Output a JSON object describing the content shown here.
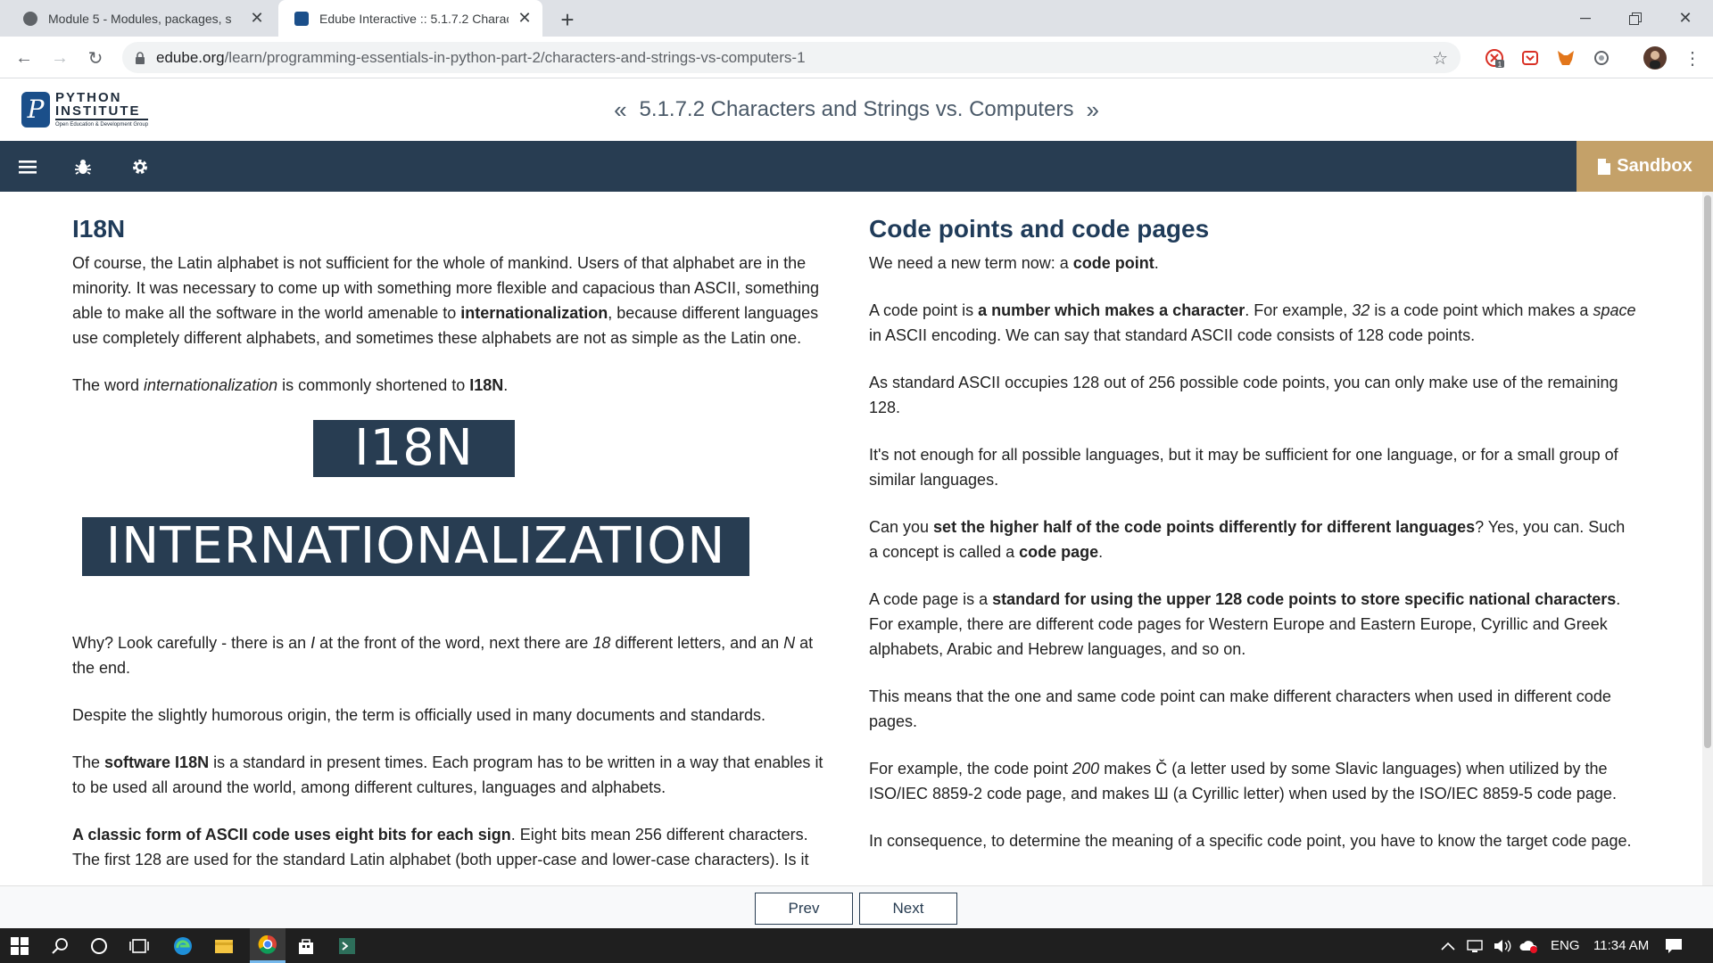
{
  "browser": {
    "tabs": [
      {
        "title": "Module 5 - Modules, packages, s",
        "active": false
      },
      {
        "title": "Edube Interactive :: 5.1.7.2 Charac",
        "active": true
      }
    ],
    "new_tab_icon": "plus-icon",
    "url_host": "edube.org",
    "url_path": "/learn/programming-essentials-in-python-part-2/characters-and-strings-vs-computers-1",
    "extension_badge": "1"
  },
  "site": {
    "logo": {
      "line1": "PYTHON",
      "line2": "INSTITUTE",
      "tagline": "Open Education & Development Group"
    },
    "lesson_title": "5.1.7.2 Characters and Strings vs. Computers",
    "prev_arrow": "«",
    "next_arrow": "»",
    "sandbox_label": "Sandbox",
    "accent_color": "#c4a169",
    "bar_color": "#283d52"
  },
  "left": {
    "heading": "I18N",
    "p1_a": "Of course, the Latin alphabet is not sufficient for the whole of mankind. Users of that alphabet are in the minority. It was necessary to come up with something more flexible and capacious than ASCII, something able to make all the software in the world amenable to ",
    "p1_b": "internationalization",
    "p1_c": ", because different languages use completely different alphabets, and sometimes these alphabets are not as simple as the Latin one.",
    "p2_a": "The word ",
    "p2_b": "internationalization",
    "p2_c": " is commonly shortened to ",
    "p2_d": "I18N",
    "p2_e": ".",
    "graphic_top": "I18N",
    "graphic_bottom": "INTERNATIONALIZATION",
    "p3_a": "Why? Look carefully - there is an ",
    "p3_b": "I",
    "p3_c": " at the front of the word, next there are ",
    "p3_d": "18",
    "p3_e": " different letters, and an ",
    "p3_f": "N",
    "p3_g": " at the end.",
    "p4": "Despite the slightly humorous origin, the term is officially used in many documents and standards.",
    "p5_a": "The ",
    "p5_b": "software I18N",
    "p5_c": " is a standard in present times. Each program has to be written in a way that enables it to be used all around the world, among different cultures, languages and alphabets.",
    "p6_a": "A classic form of ASCII code uses eight bits for each sign",
    "p6_b": ". Eight bits mean 256 different characters. The first 128 are used for the standard Latin alphabet (both upper-case and lower-case characters). Is it"
  },
  "right": {
    "heading": "Code points and code pages",
    "p1_a": "We need a new term now: a ",
    "p1_b": "code point",
    "p1_c": ".",
    "p2_a": "A code point is ",
    "p2_b": "a number which makes a character",
    "p2_c": ". For example, ",
    "p2_d": "32",
    "p2_e": " is a code point which makes a ",
    "p2_f": "space",
    "p2_g": " in ASCII encoding. We can say that standard ASCII code consists of 128 code points.",
    "p3": "As standard ASCII occupies 128 out of 256 possible code points, you can only make use of the remaining 128.",
    "p4": "It's not enough for all possible languages, but it may be sufficient for one language, or for a small group of similar languages.",
    "p5_a": "Can you ",
    "p5_b": "set the higher half of the code points differently for different languages",
    "p5_c": "? Yes, you can. Such a concept is called a ",
    "p5_d": "code page",
    "p5_e": ".",
    "p6_a": "A code page is a ",
    "p6_b": "standard for using the upper 128 code points to store specific national characters",
    "p6_c": ". For example, there are different code pages for Western Europe and Eastern Europe, Cyrillic and Greek alphabets, Arabic and Hebrew languages, and so on.",
    "p7": "This means that the one and same code point can make different characters when used in different code pages.",
    "p8_a": "For example, the code point ",
    "p8_b": "200",
    "p8_c": " makes Č (a letter used by some Slavic languages) when utilized by the ISO/IEC 8859-2 code page, and makes Ш (a Cyrillic letter) when used by the ISO/IEC 8859-5 code page.",
    "p9": "In consequence, to determine the meaning of a specific code point, you have to know the target code page."
  },
  "footer": {
    "prev_label": "Prev",
    "next_label": "Next"
  },
  "taskbar": {
    "language": "ENG",
    "time": "11:34 AM"
  }
}
